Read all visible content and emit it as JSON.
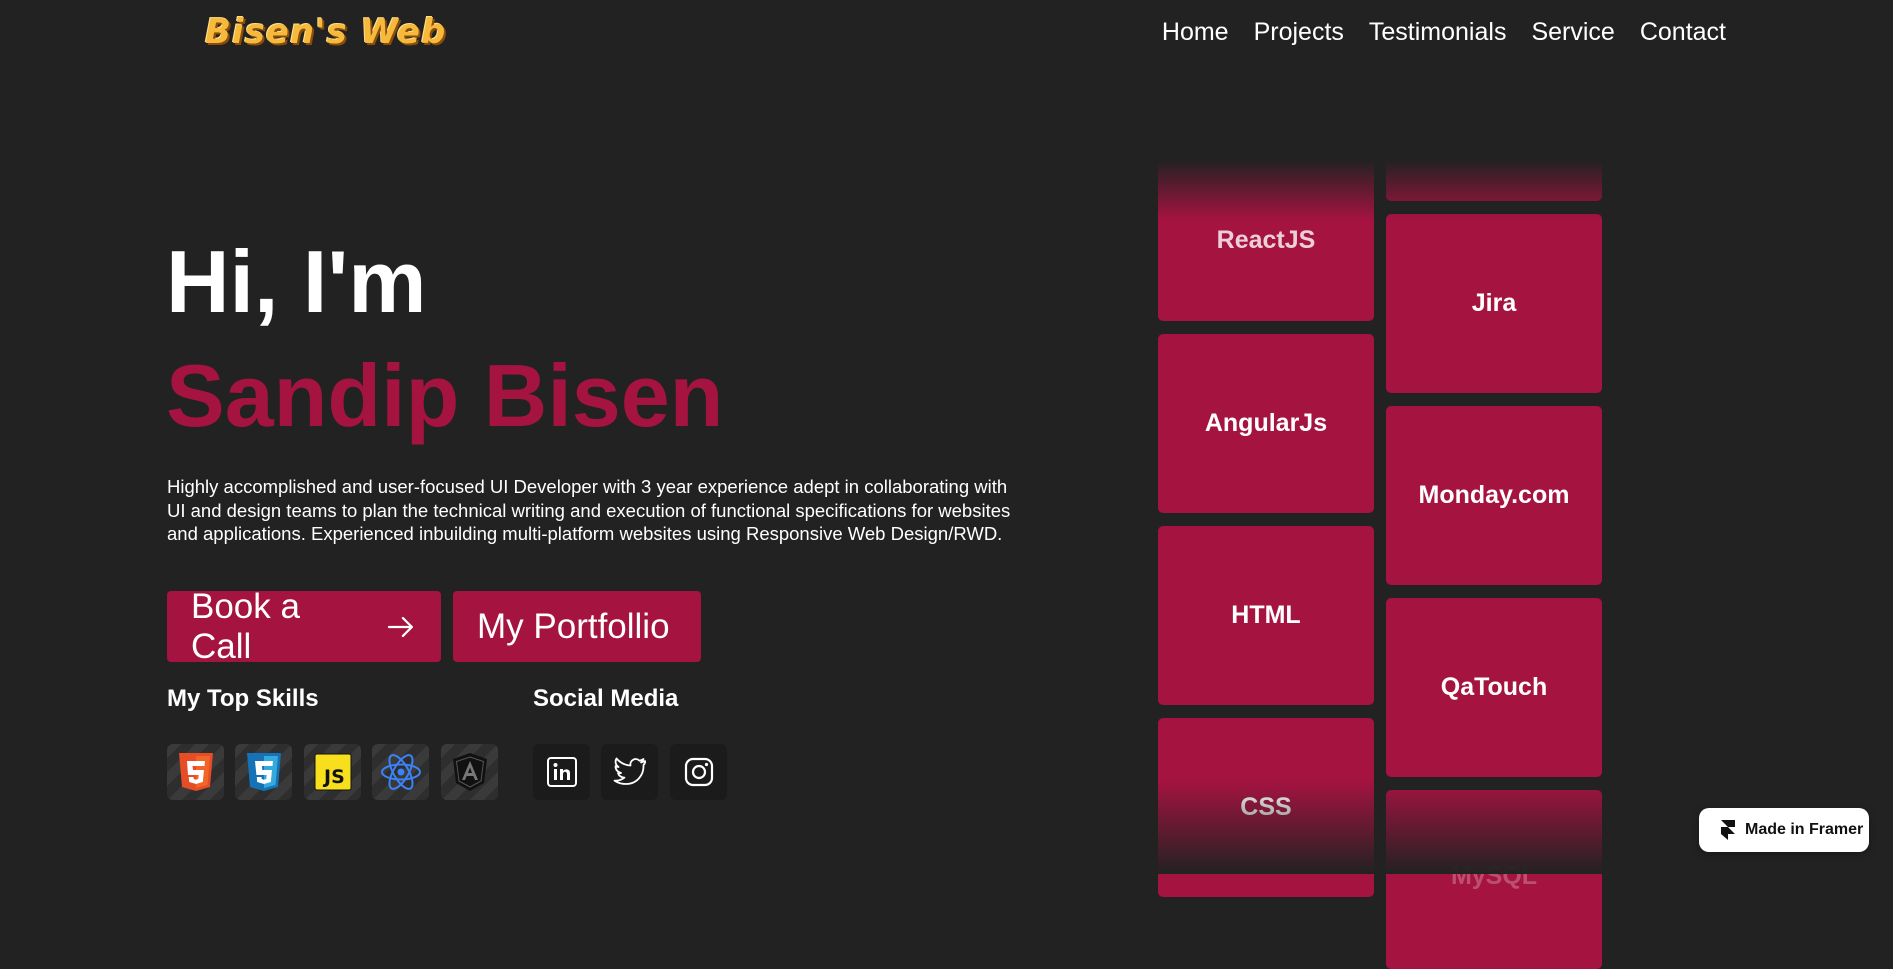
{
  "header": {
    "logo_text": "Bisen's Web",
    "nav": [
      "Home",
      "Projects",
      "Testimonials",
      "Service",
      "Contact"
    ]
  },
  "hero": {
    "greeting": "Hi, I'm",
    "name": "Sandip Bisen",
    "description": "Highly accomplished and user-focused UI Developer with 3 year experience adept in collaborating with UI and design teams to plan the technical writing and execution of functional specifications for websites and applications. Experienced inbuilding multi-platform websites using Responsive Web Design/RWD.",
    "cta_primary": "Book a Call",
    "cta_secondary": "My Portfollio"
  },
  "skills": {
    "title": "My Top Skills",
    "icons": [
      "html5-icon",
      "css3-icon",
      "javascript-icon",
      "react-icon",
      "angular-icon"
    ]
  },
  "social": {
    "title": "Social Media",
    "icons": [
      "linkedin-icon",
      "twitter-icon",
      "instagram-icon"
    ]
  },
  "tiles": {
    "left": [
      "ReactJS",
      "AngularJs",
      "HTML",
      "CSS"
    ],
    "right": [
      "",
      "Jira",
      "Monday.com",
      "QaTouch",
      "MySQL"
    ]
  },
  "badge": {
    "label": "Made in Framer"
  },
  "colors": {
    "background": "#222222",
    "accent": "#a51341",
    "logo": "#f6b93b"
  }
}
